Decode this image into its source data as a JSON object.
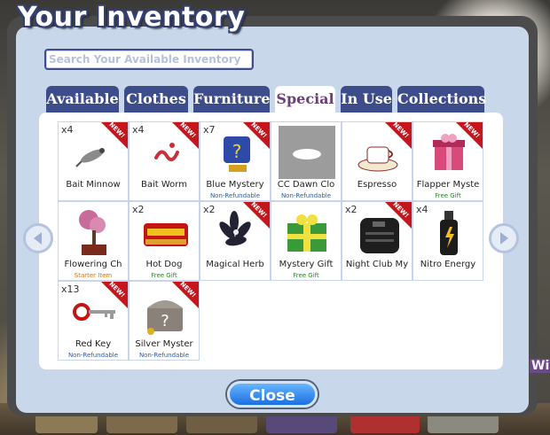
{
  "dialog": {
    "title": "Your Inventory",
    "search_placeholder": "Search Your Available Inventory",
    "close_label": "Close"
  },
  "tabs": [
    {
      "label": "Available",
      "active": false
    },
    {
      "label": "Clothes",
      "active": false
    },
    {
      "label": "Furniture",
      "active": false
    },
    {
      "label": "Special",
      "active": true
    },
    {
      "label": "In Use",
      "active": false
    },
    {
      "label": "Collections",
      "active": false
    }
  ],
  "new_badge": "NEW!",
  "items": [
    {
      "name": "Bait Minnow",
      "qty": "x4",
      "new": true,
      "note": "",
      "icon": "fish-lure-icon"
    },
    {
      "name": "Bait Worm",
      "qty": "x4",
      "new": true,
      "note": "",
      "icon": "worm-icon"
    },
    {
      "name": "Blue Mystery",
      "qty": "x7",
      "new": true,
      "note": "Non-Refundable",
      "icon": "mystery-box-icon"
    },
    {
      "name": "CC Dawn Clo",
      "qty": "",
      "new": false,
      "note": "Non-Refundable",
      "icon": "cloud-icon"
    },
    {
      "name": "Espresso",
      "qty": "",
      "new": true,
      "note": "",
      "icon": "espresso-cup-icon"
    },
    {
      "name": "Flapper Myste",
      "qty": "",
      "new": true,
      "note": "Free Gift",
      "icon": "gift-box-icon"
    },
    {
      "name": "Flowering Ch",
      "qty": "",
      "new": false,
      "note": "Starter Item",
      "icon": "bonsai-tree-icon"
    },
    {
      "name": "Hot Dog",
      "qty": "x2",
      "new": false,
      "note": "Free Gift",
      "icon": "hot-dog-icon"
    },
    {
      "name": "Magical Herb",
      "qty": "x2",
      "new": true,
      "note": "",
      "icon": "herb-icon"
    },
    {
      "name": "Mystery Gift",
      "qty": "",
      "new": false,
      "note": "Free Gift",
      "icon": "green-gift-icon"
    },
    {
      "name": "Night Club My",
      "qty": "x2",
      "new": true,
      "note": "",
      "icon": "black-box-icon"
    },
    {
      "name": "Nitro Energy",
      "qty": "x4",
      "new": false,
      "note": "",
      "icon": "energy-bottle-icon"
    },
    {
      "name": "Red Key",
      "qty": "x13",
      "new": true,
      "note": "Non-Refundable",
      "icon": "key-icon"
    },
    {
      "name": "Silver Myster",
      "qty": "",
      "new": true,
      "note": "Non-Refundable",
      "icon": "treasure-chest-icon"
    }
  ],
  "colors": {
    "tab_bg": "#3d4c8a",
    "active_tab_text": "#6c3f76",
    "new_ribbon": "#c4161c",
    "panel_bg": "#c9d7ea"
  }
}
